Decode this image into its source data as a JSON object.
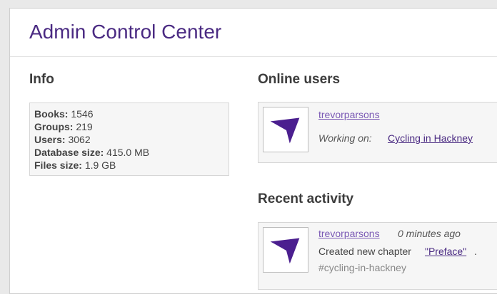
{
  "header": {
    "title": "Admin Control Center"
  },
  "info": {
    "title": "Info",
    "rows": [
      {
        "label": "Books:",
        "value": "1546"
      },
      {
        "label": "Groups:",
        "value": "219"
      },
      {
        "label": "Users:",
        "value": "3062"
      },
      {
        "label": "Database size:",
        "value": "415.0 MB"
      },
      {
        "label": "Files size:",
        "value": "1.9 GB"
      }
    ]
  },
  "online_users": {
    "title": "Online users",
    "items": [
      {
        "username": "trevorparsons",
        "working_label": "Working on:",
        "book": "Cycling in Hackney"
      }
    ]
  },
  "recent_activity": {
    "title": "Recent activity",
    "items": [
      {
        "username": "trevorparsons",
        "time": "0 minutes ago",
        "action_prefix": "Created new chapter",
        "chapter": "\"Preface\"",
        "suffix": ".",
        "tag": "#cycling-in-hackney"
      }
    ]
  },
  "colors": {
    "accent": "#4a2a82",
    "link": "#7b5ab5",
    "logo": "#4b1f8f"
  },
  "icons": {
    "avatar": "booktype-logo-icon"
  }
}
